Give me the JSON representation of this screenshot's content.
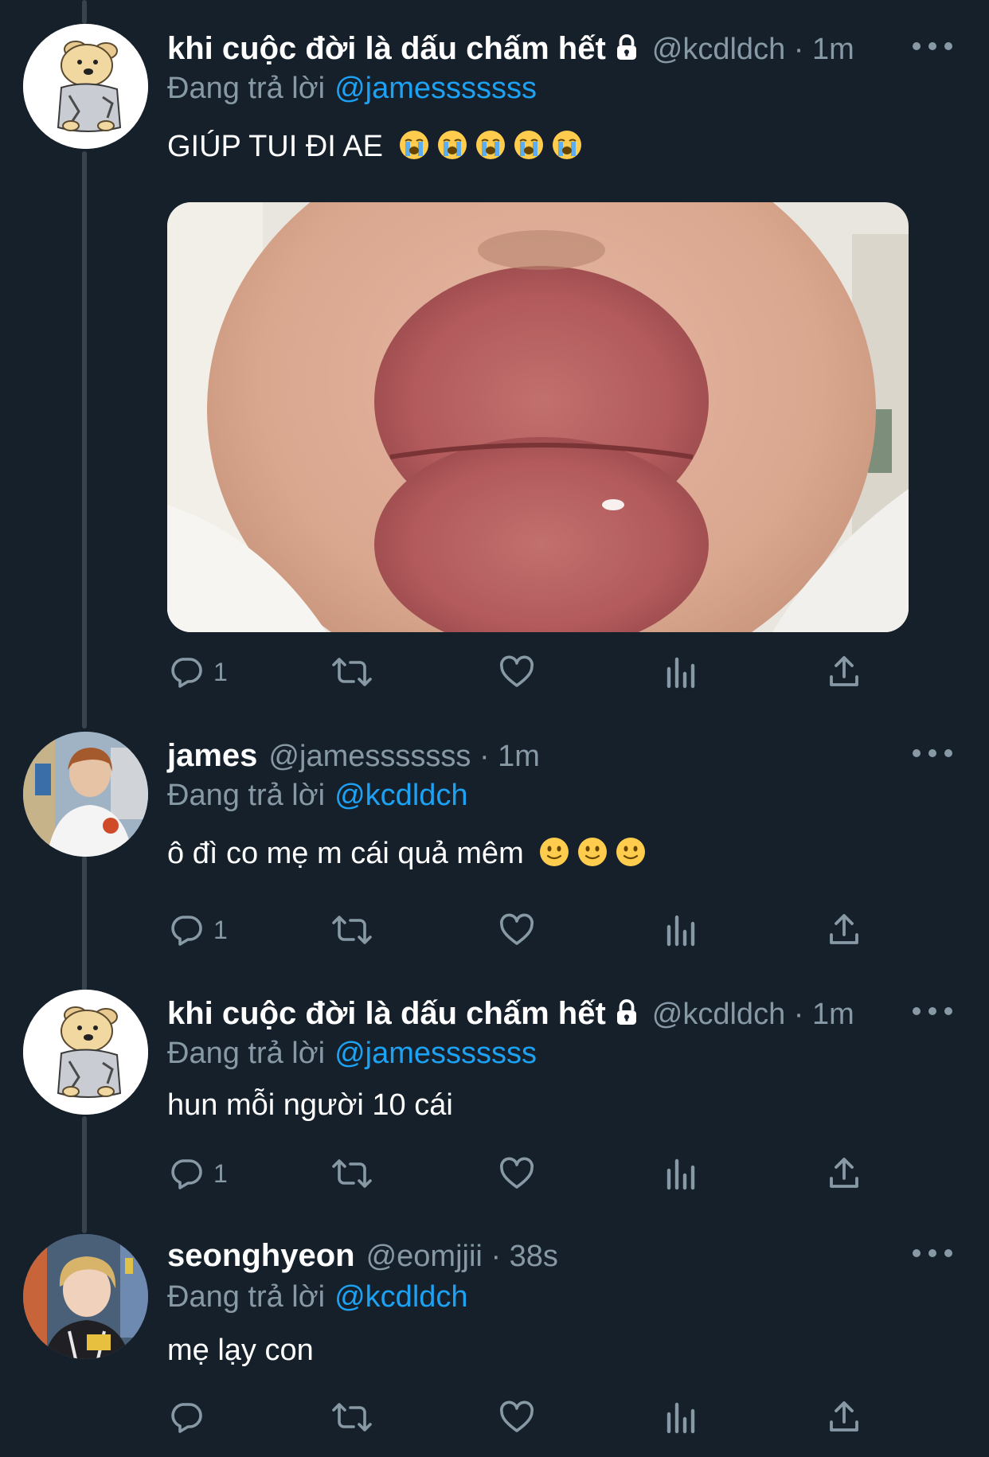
{
  "colors": {
    "background": "#15202b",
    "secondary_text": "#8899a6",
    "link": "#1da1f2",
    "thread_line": "#38444d"
  },
  "reply_prefix": "Đang trả lời",
  "tweets": [
    {
      "display_name": "khi cuộc đời là dấu chấm hết",
      "locked": true,
      "handle": "@kcdldch",
      "separator": "·",
      "time": "1m",
      "replying_to": "@jamesssssss",
      "text": "GIÚP TUI ĐI AE",
      "emojis": [
        "loudly-crying-face",
        "loudly-crying-face",
        "loudly-crying-face",
        "loudly-crying-face",
        "loudly-crying-face"
      ],
      "avatar": "dog-illustration",
      "has_media": true,
      "reply_count": "1"
    },
    {
      "display_name": "james",
      "locked": false,
      "handle": "@jamesssssss",
      "separator": "·",
      "time": "1m",
      "replying_to": "@kcdldch",
      "text": "ô đì co mẹ m cái quả mêm",
      "emojis": [
        "slightly-smiling-face",
        "slightly-smiling-face",
        "slightly-smiling-face"
      ],
      "avatar": "person-photo",
      "has_media": false,
      "reply_count": "1"
    },
    {
      "display_name": "khi cuộc đời là dấu chấm hết",
      "locked": true,
      "handle": "@kcdldch",
      "separator": "·",
      "time": "1m",
      "replying_to": "@jamesssssss",
      "text": "hun mỗi người 10 cái",
      "emojis": [],
      "avatar": "dog-illustration",
      "has_media": false,
      "reply_count": "1"
    },
    {
      "display_name": "seonghyeon",
      "locked": false,
      "handle": "@eomjjii",
      "separator": "·",
      "time": "38s",
      "replying_to": "@kcdldch",
      "text": "mẹ lạy con",
      "emojis": [],
      "avatar": "person-photo",
      "has_media": false,
      "reply_count": ""
    }
  ]
}
